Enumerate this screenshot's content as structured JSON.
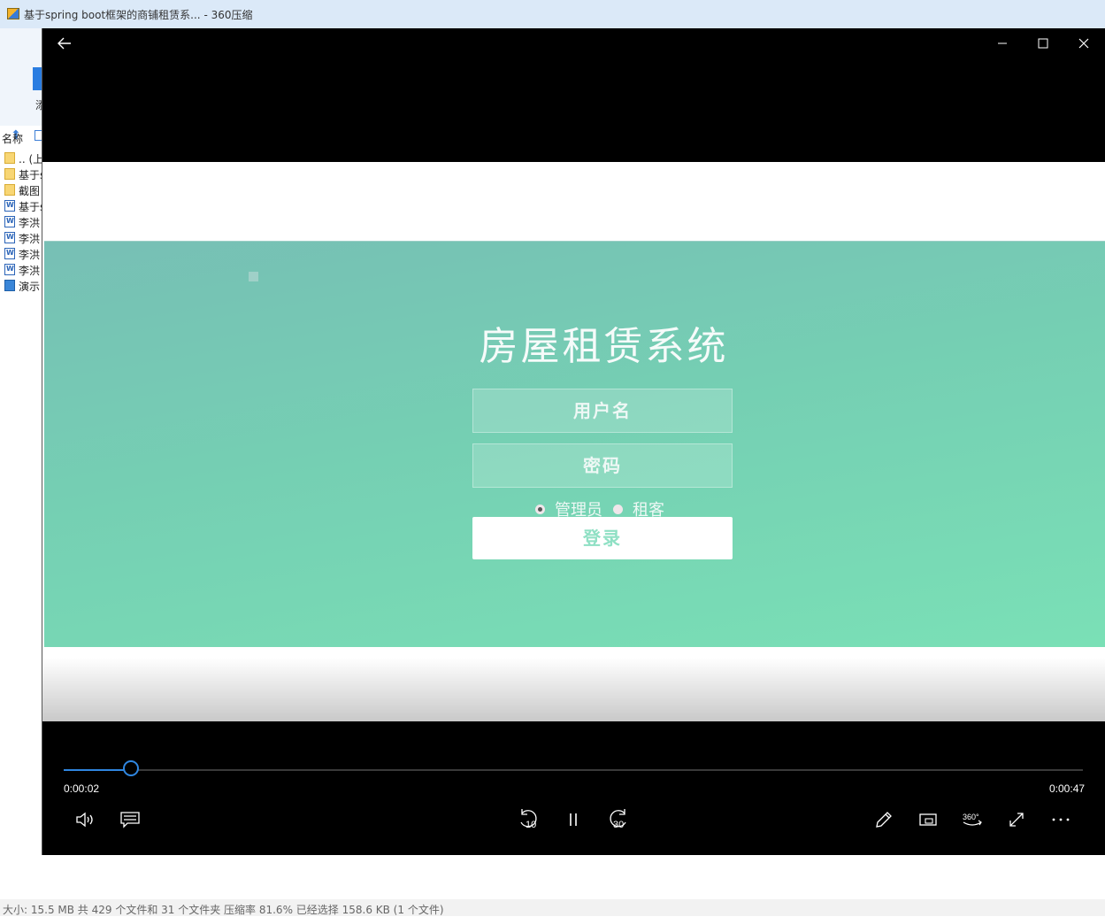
{
  "bg_window": {
    "title": "基于spring boot框架的商铺租赁系... - 360压缩",
    "toolbar_label": "添",
    "column_name": "名称",
    "files": [
      {
        "name": ".. (上",
        "kind": "folder"
      },
      {
        "name": "基于s",
        "kind": "folder"
      },
      {
        "name": "截图",
        "kind": "folder"
      },
      {
        "name": "基于s",
        "kind": "doc"
      },
      {
        "name": "李洪",
        "kind": "doc"
      },
      {
        "name": "李洪",
        "kind": "doc"
      },
      {
        "name": "李洪",
        "kind": "doc"
      },
      {
        "name": "李洪",
        "kind": "doc"
      },
      {
        "name": "演示",
        "kind": "video"
      }
    ],
    "status": "大小: 15.5 MB 共 429 个文件和 31 个文件夹 压缩率 81.6% 已经选择 158.6 KB (1 个文件)"
  },
  "player": {
    "video": {
      "title": "房屋租赁系统",
      "username_placeholder": "用户名",
      "password_placeholder": "密码",
      "role_admin": "管理员",
      "role_tenant": "租客",
      "selected_role": "admin",
      "login_label": "登录"
    },
    "controls": {
      "current_time": "0:00:02",
      "total_time": "0:00:47",
      "progress": 0.066,
      "rewind_seconds": "10",
      "forward_seconds": "30",
      "vr_label": "360°"
    },
    "accent_color": "#2f86e0"
  }
}
